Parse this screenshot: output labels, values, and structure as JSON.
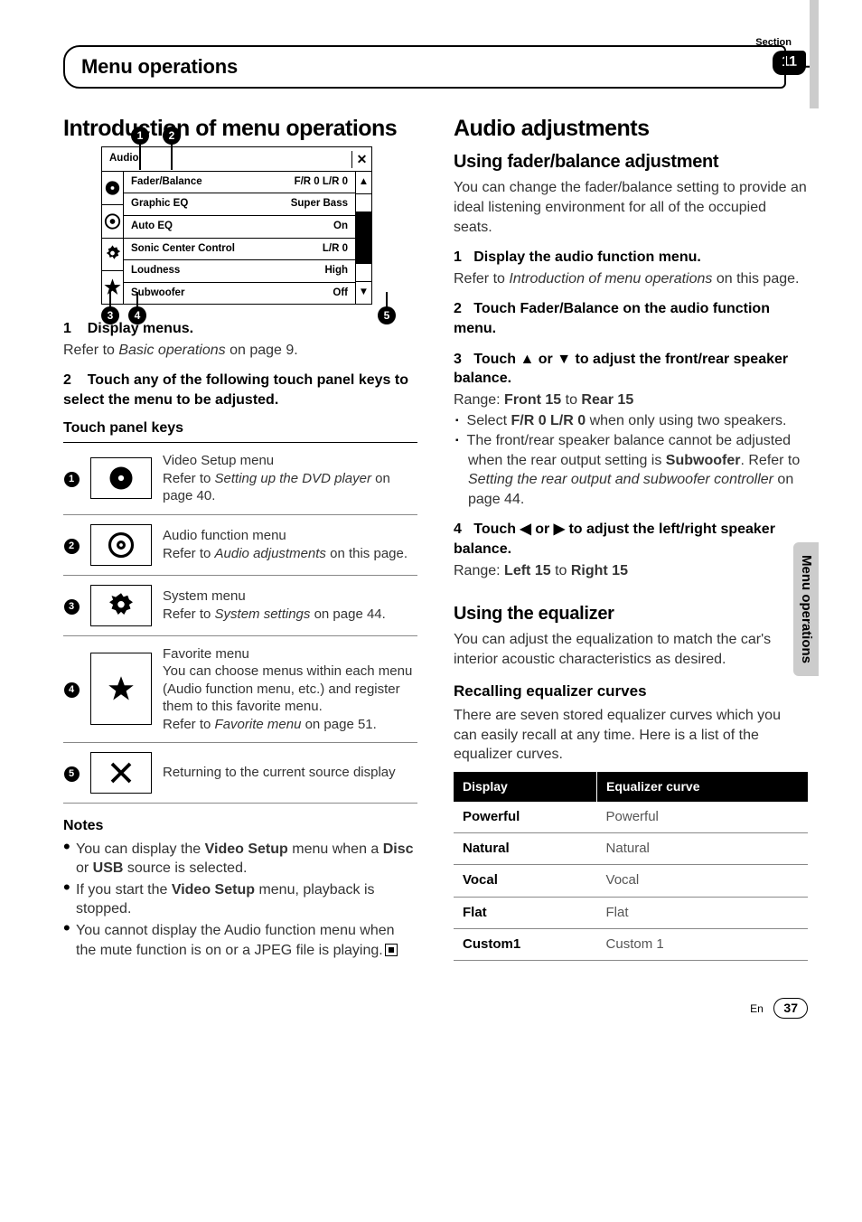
{
  "header": {
    "section_label": "Section",
    "section_number": "11",
    "title": "Menu operations"
  },
  "side_tab": "Menu operations",
  "left": {
    "h1": "Introduction of menu operations",
    "menu_mock": {
      "title": "Audio",
      "rows": [
        {
          "label": "Fader/Balance",
          "value": "F/R  0 L/R  0"
        },
        {
          "label": "Graphic EQ",
          "value": "Super Bass"
        },
        {
          "label": "Auto EQ",
          "value": "On"
        },
        {
          "label": "Sonic Center Control",
          "value": "L/R 0"
        },
        {
          "label": "Loudness",
          "value": "High"
        },
        {
          "label": "Subwoofer",
          "value": "Off"
        }
      ],
      "callouts": [
        "1",
        "2",
        "3",
        "4",
        "5"
      ]
    },
    "step1": {
      "num": "1",
      "text": "Display menus.",
      "after": "Refer to ",
      "italic": "Basic operations",
      "after2": " on page 9."
    },
    "step2": {
      "num": "2",
      "text": "Touch any of the following touch panel keys to select the menu to be adjusted."
    },
    "tpk_title": "Touch panel keys",
    "tpk_rows": [
      {
        "n": "1",
        "icon": "disc",
        "title": "Video Setup menu",
        "refer": "Setting up the DVD player",
        "page": "40"
      },
      {
        "n": "2",
        "icon": "disc-ring",
        "title": "Audio function menu",
        "refer": "Audio adjustments",
        "page": "this page"
      },
      {
        "n": "3",
        "icon": "gear",
        "title": "System menu",
        "refer": "System settings",
        "page": "44"
      },
      {
        "n": "4",
        "icon": "star",
        "title": "Favorite menu",
        "extra": "You can choose menus within each menu (Audio function menu, etc.) and register them to this favorite menu.",
        "refer": "Favorite menu",
        "page": "51"
      },
      {
        "n": "5",
        "icon": "close",
        "title": "Returning to the current source display"
      }
    ],
    "notes_hdr": "Notes",
    "notes": [
      {
        "pre": "You can display the ",
        "b1": "Video Setup",
        "mid": " menu when a ",
        "b2": "Disc",
        "mid2": " or ",
        "b3": "USB",
        "post": " source is selected."
      },
      {
        "pre": "If you start the ",
        "b1": "Video Setup",
        "post": " menu, playback is stopped."
      },
      {
        "plain": "You cannot display the Audio function menu when the mute function is on or a JPEG file is playing."
      }
    ]
  },
  "right": {
    "h1": "Audio adjustments",
    "h2a": "Using fader/balance adjustment",
    "intro_a": "You can change the fader/balance setting to provide an ideal listening environment for all of the occupied seats.",
    "steps_a": [
      {
        "num": "1",
        "bold": "Display the audio function menu.",
        "after": "Refer to ",
        "italic": "Introduction of menu operations",
        "after2": " on this page."
      },
      {
        "num": "2",
        "bold": "Touch Fader/Balance on the audio function menu."
      },
      {
        "num": "3",
        "bold": "Touch ▲ or ▼ to adjust the front/rear speaker balance.",
        "range_pre": "Range: ",
        "range_b1": "Front 15",
        "range_mid": " to ",
        "range_b2": "Rear 15",
        "bullets": [
          {
            "pre": "Select ",
            "b": "F/R 0  L/R 0",
            "post": " when only using two speakers."
          },
          {
            "pre": "The front/rear speaker balance cannot be adjusted when the rear output setting is ",
            "b": "Subwoofer",
            "post": ". Refer to ",
            "i": "Setting the rear output and subwoofer controller",
            "post2": " on page 44."
          }
        ]
      },
      {
        "num": "4",
        "bold": "Touch ◀ or ▶ to adjust the left/right speaker balance.",
        "range_pre": "Range: ",
        "range_b1": "Left 15",
        "range_mid": " to ",
        "range_b2": "Right 15"
      }
    ],
    "h2b": "Using the equalizer",
    "intro_b": "You can adjust the equalization to match the car's interior acoustic characteristics as desired.",
    "h3a": "Recalling equalizer curves",
    "recall_intro": "There are seven stored equalizer curves which you can easily recall at any time. Here is a list of the equalizer curves.",
    "eq_headers": [
      "Display",
      "Equalizer curve"
    ],
    "eq_rows": [
      {
        "d": "Powerful",
        "c": "Powerful"
      },
      {
        "d": "Natural",
        "c": "Natural"
      },
      {
        "d": "Vocal",
        "c": "Vocal"
      },
      {
        "d": "Flat",
        "c": "Flat"
      },
      {
        "d": "Custom1",
        "c": "Custom 1"
      }
    ]
  },
  "footer": {
    "lang": "En",
    "page": "37"
  }
}
